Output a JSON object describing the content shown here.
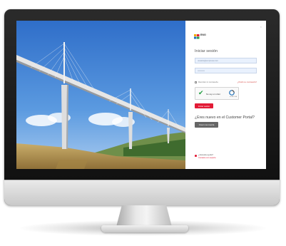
{
  "window": {
    "close_glyph": "×"
  },
  "logo": {
    "text": "ENG",
    "colors": [
      "#f2a900",
      "#e21b36",
      "#1c6fb8",
      "#2e9b48"
    ]
  },
  "login": {
    "title": "Iniciar sesión",
    "email_value": "usuario@empresa.com",
    "password_value": "••••••••••",
    "remember_label": "Recordar mi contraseña",
    "forgot_label": "¿Olvidó su contraseña?",
    "captcha_label": "No soy un robot",
    "captcha_brand": "reCAPTCHA",
    "submit_label": "Iniciar sesión"
  },
  "signup": {
    "title": "¿Eres nuevo en el Customer Portal?",
    "button_label": "Crear una cuenta"
  },
  "help": {
    "line1": "¿Necesita ayuda?",
    "line2": "Contacte con soporte"
  },
  "colors": {
    "accent": "#e21b36",
    "secondary_button": "#666666"
  }
}
